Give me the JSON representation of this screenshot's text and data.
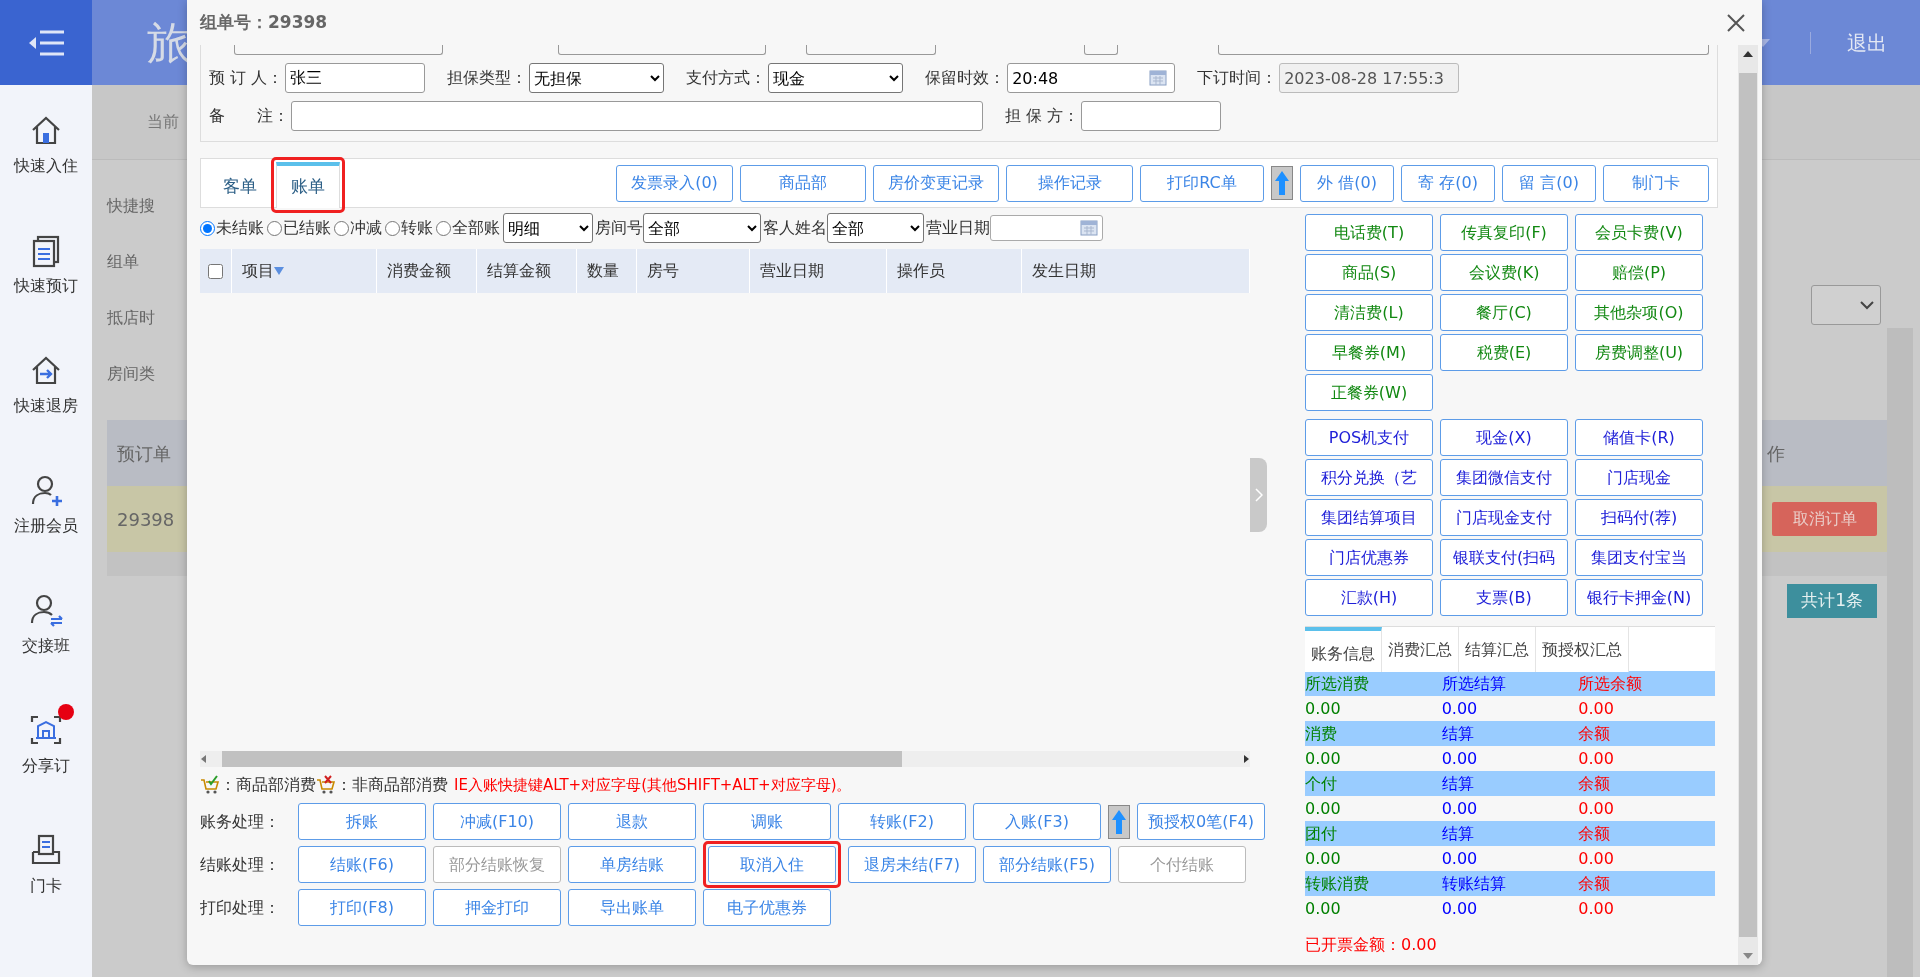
{
  "app": {
    "header_title": "旅",
    "logout": "退出",
    "sub_nav": "当前",
    "sidebar": [
      {
        "label": "快速入住",
        "notification": false
      },
      {
        "label": "快速预订",
        "notification": false
      },
      {
        "label": "快速退房",
        "notification": false
      },
      {
        "label": "注册会员",
        "notification": false
      },
      {
        "label": "交接班",
        "notification": false
      },
      {
        "label": "分享订",
        "notification": true
      },
      {
        "label": "门卡",
        "notification": false
      }
    ],
    "search_labels": [
      "快捷搜",
      "组单",
      "抵店时",
      "房间类"
    ],
    "orders_table": {
      "column_1": "预订单",
      "column_last": "作",
      "row": {
        "order_no": "29398",
        "action": "取消订单"
      }
    },
    "total": "共计1条"
  },
  "modal": {
    "title": "组单号：29398",
    "booking_rows": [
      [
        {
          "label": "预 订 人：",
          "kind": "text",
          "value": "张三"
        },
        {
          "label": "担保类型：",
          "kind": "select",
          "value": "无担保"
        },
        {
          "label": "支付方式：",
          "kind": "select",
          "value": "现金"
        },
        {
          "label": "保留时效：",
          "kind": "date",
          "value": "20:48"
        },
        {
          "label": "下订时间：",
          "kind": "readonly",
          "value": "2023-08-28 17:55:3"
        }
      ],
      [
        {
          "label": "备　　注：",
          "kind": "memo"
        },
        {
          "label": "担 保 方：",
          "kind": "text"
        }
      ]
    ],
    "tabs": [
      {
        "label": "客单",
        "selected": false,
        "highlighted": false
      },
      {
        "label": "账单",
        "selected": true,
        "highlighted": true
      }
    ],
    "toolbar": [
      {
        "kind": "button",
        "label": "发票录入(0)"
      },
      {
        "kind": "button",
        "label": "商品部"
      },
      {
        "kind": "button",
        "label": "房价变更记录"
      },
      {
        "kind": "button",
        "label": "操作记录"
      },
      {
        "kind": "button",
        "label": "打印RC单"
      },
      {
        "kind": "arrow"
      },
      {
        "kind": "button",
        "label": "外 借(0)"
      },
      {
        "kind": "button",
        "label": "寄 存(0)"
      },
      {
        "kind": "button",
        "label": "留 言(0)"
      },
      {
        "kind": "button",
        "label": "制门卡"
      }
    ],
    "filters": {
      "radios": [
        {
          "label": "未结账",
          "selected": true
        },
        {
          "label": "已结账",
          "selected": false
        },
        {
          "label": "冲减",
          "selected": false
        },
        {
          "label": "转账",
          "selected": false
        },
        {
          "label": "全部账",
          "selected": false
        }
      ],
      "view": "明细",
      "room_label": "房间号",
      "room": "全部",
      "guest_label": "客人姓名",
      "guest": "全部",
      "date_label": "营业日期"
    },
    "bill_table": {
      "select_all_checked": false,
      "columns": [
        "项目",
        "消费金额",
        "结算金额",
        "数量",
        "房号",
        "营业日期",
        "操作员",
        "发生日期"
      ]
    },
    "legend": {
      "goods": "：商品部消费",
      "non_goods": "：非商品部消费",
      "hint": "IE入账快捷键ALT+对应字母(其他SHIFT+ALT+对应字母)。"
    },
    "actions": [
      {
        "label": "账务处理：",
        "buttons": [
          {
            "kind": "button",
            "label": "拆账",
            "disabled": false,
            "highlighted": false
          },
          {
            "kind": "button",
            "label": "冲减(F10)",
            "disabled": false,
            "highlighted": false
          },
          {
            "kind": "button",
            "label": "退款",
            "disabled": false,
            "highlighted": false
          },
          {
            "kind": "button",
            "label": "调账",
            "disabled": false,
            "highlighted": false
          },
          {
            "kind": "button",
            "label": "转账(F2)",
            "disabled": false,
            "highlighted": false
          },
          {
            "kind": "button",
            "label": "入账(F3)",
            "disabled": false,
            "highlighted": false
          },
          {
            "kind": "arrow"
          },
          {
            "kind": "button",
            "label": "预授权0笔(F4)",
            "disabled": false,
            "highlighted": false
          }
        ]
      },
      {
        "label": "结账处理：",
        "buttons": [
          {
            "kind": "button",
            "label": "结账(F6)",
            "disabled": false,
            "highlighted": false
          },
          {
            "kind": "button",
            "label": "部分结账恢复",
            "disabled": true,
            "highlighted": false
          },
          {
            "kind": "button",
            "label": "单房结账",
            "disabled": false,
            "highlighted": false
          },
          {
            "kind": "button",
            "label": "取消入住",
            "disabled": false,
            "highlighted": true
          },
          {
            "kind": "button",
            "label": "退房未结(F7)",
            "disabled": false,
            "highlighted": false
          },
          {
            "kind": "button",
            "label": "部分结账(F5)",
            "disabled": false,
            "highlighted": false
          },
          {
            "kind": "button",
            "label": "个付结账",
            "disabled": true,
            "highlighted": false
          }
        ]
      },
      {
        "label": "打印处理：",
        "buttons": [
          {
            "kind": "button",
            "label": "打印(F8)",
            "disabled": false,
            "highlighted": false
          },
          {
            "kind": "button",
            "label": "押金打印",
            "disabled": false,
            "highlighted": false
          },
          {
            "kind": "button",
            "label": "导出账单",
            "disabled": false,
            "highlighted": false
          },
          {
            "kind": "button",
            "label": "电子优惠券",
            "disabled": false,
            "highlighted": false
          }
        ]
      }
    ],
    "charge_items": [
      "电话费(T)",
      "传真复印(F)",
      "会员卡费(V)",
      "商品(S)",
      "会议费(K)",
      "赔偿(P)",
      "清洁费(L)",
      "餐厅(C)",
      "其他杂项(O)",
      "早餐券(M)",
      "税费(E)",
      "房费调整(U)",
      "正餐券(W)"
    ],
    "payment_items": [
      "POS机支付",
      "现金(X)",
      "储值卡(R)",
      "积分兑换（艺",
      "集团微信支付",
      "门店现金",
      "集团结算项目",
      "门店现金支付",
      "扫码付(荐)",
      "门店优惠券",
      "银联支付(扫码",
      "集团支付宝当",
      "汇款(H)",
      "支票(B)",
      "银行卡押金(N)"
    ],
    "summary": {
      "tabs": [
        {
          "label": "账务信息",
          "selected": true
        },
        {
          "label": "消费汇总",
          "selected": false
        },
        {
          "label": "结算汇总",
          "selected": false
        },
        {
          "label": "预授权汇总",
          "selected": false
        }
      ],
      "groups": [
        {
          "labels": [
            "所选消费",
            "所选结算",
            "所选余额"
          ],
          "values": [
            "0.00",
            "0.00",
            "0.00"
          ]
        },
        {
          "labels": [
            "消费",
            "结算",
            "余额"
          ],
          "values": [
            "0.00",
            "0.00",
            "0.00"
          ]
        },
        {
          "labels": [
            "个付",
            "结算",
            "余额"
          ],
          "values": [
            "0.00",
            "0.00",
            "0.00"
          ]
        },
        {
          "labels": [
            "团付",
            "结算",
            "余额"
          ],
          "values": [
            "0.00",
            "0.00",
            "0.00"
          ]
        },
        {
          "labels": [
            "转账消费",
            "转账结算",
            "余额"
          ],
          "values": [
            "0.00",
            "0.00",
            "0.00"
          ]
        }
      ]
    },
    "invoiced": "已开票金额：0.00"
  }
}
